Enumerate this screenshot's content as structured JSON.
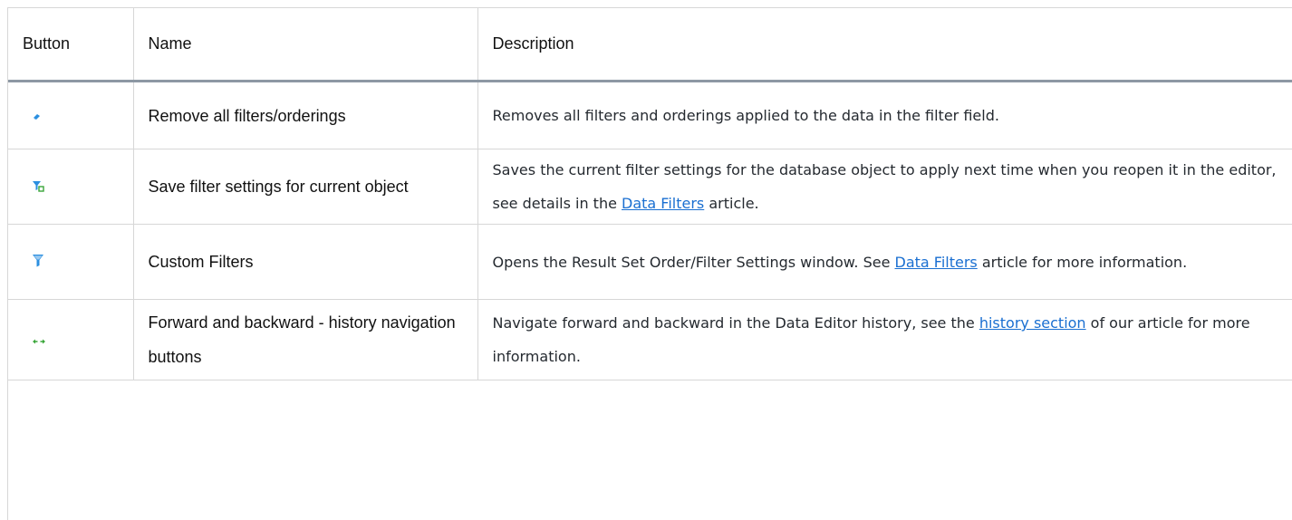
{
  "table": {
    "headers": {
      "button": "Button",
      "name": "Name",
      "description": "Description"
    },
    "rows": [
      {
        "icon": "eraser-icon",
        "name": "Remove all filters/orderings",
        "desc_before": "Removes all filters and orderings applied to the data in the filter field.",
        "link": "",
        "desc_after": ""
      },
      {
        "icon": "filter-save-icon",
        "name": "Save filter settings for current object",
        "desc_before": "Saves the current filter settings for the database object to apply next time when you reopen it in the editor, see details in the ",
        "link": "Data Filters",
        "desc_after": " article."
      },
      {
        "icon": "filter-icon",
        "name": "Custom Filters",
        "desc_before": "Opens the Result Set Order/Filter Settings window. See ",
        "link": "Data Filters",
        "desc_after": " article for more information."
      },
      {
        "icon": "forward-backward-arrows-icon",
        "name": "Forward and backward - history navigation buttons",
        "desc_before": "Navigate forward and backward in the Data Editor history, see the ",
        "link": "history section",
        "desc_after": " of our article for more information."
      }
    ]
  },
  "colors": {
    "border": "#d7d7d7",
    "header_rule": "#8d98a4",
    "link": "#1a6fd1",
    "icon_blue": "#2b8fe0",
    "icon_green": "#3aa63a"
  }
}
